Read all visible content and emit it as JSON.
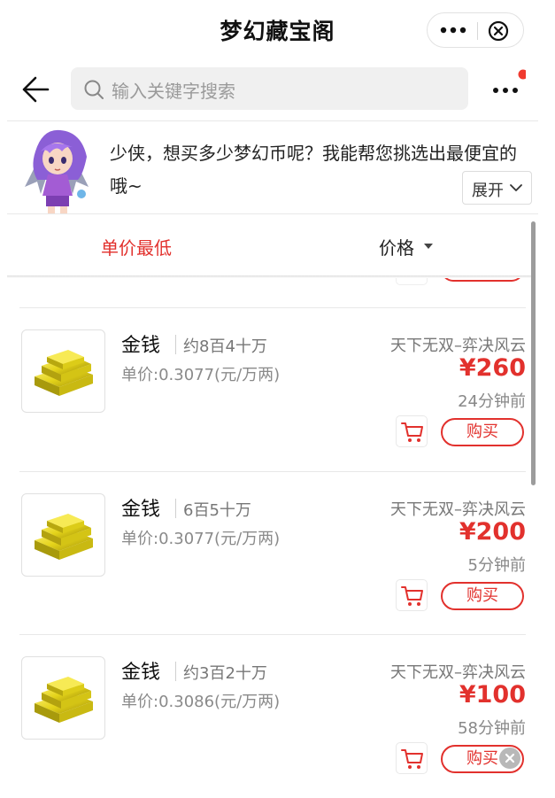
{
  "window": {
    "title": "梦幻藏宝阁",
    "more_icon": "more-dots-icon",
    "close_icon": "close-circle-icon"
  },
  "search": {
    "placeholder": "输入关键字搜索",
    "back_icon": "back-arrow-icon",
    "menu_icon": "menu-dots-icon",
    "has_notification_dot": true
  },
  "banner": {
    "message": "少侠，想买多少梦幻币呢？我能帮您挑选出最便宜的哦~",
    "expand_label": "展开"
  },
  "sort": {
    "unit_price_label": "单价最低",
    "price_label": "价格",
    "active": "unit_price"
  },
  "items": [
    {
      "name": "金钱",
      "amount": "约8百4十万",
      "unit_price": "单价:0.3077(元/万两)",
      "server": "天下无双–弈决风云",
      "price": "¥260",
      "time": "24分钟前",
      "buy_label": "购买"
    },
    {
      "name": "金钱",
      "amount": "6百5十万",
      "unit_price": "单价:0.3077(元/万两)",
      "server": "天下无双–弈决风云",
      "price": "¥200",
      "time": "5分钟前",
      "buy_label": "购买"
    },
    {
      "name": "金钱",
      "amount": "约3百2十万",
      "unit_price": "单价:0.3086(元/万两)",
      "server": "天下无双–弈决风云",
      "price": "¥100",
      "time": "58分钟前",
      "buy_label": "购买"
    }
  ],
  "colors": {
    "accent": "#e2312d",
    "notification": "#f03a2f"
  }
}
